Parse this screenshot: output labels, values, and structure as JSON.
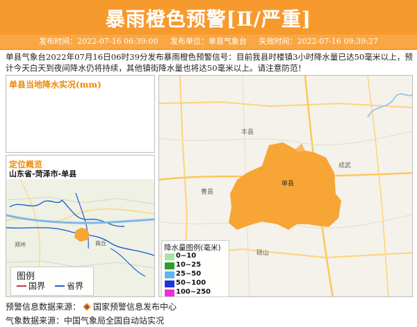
{
  "header": {
    "title": "暴雨橙色预警[Ⅱ/严重]",
    "publish_time": "发布时间：2022-07-16 06:39:00",
    "publisher": "发布单位：单县气象台",
    "expire_time": "失效时间：2022-07-16 09:39:27",
    "color": "#f79a2e"
  },
  "description": "单县气象台2022年07月16日06时39分发布暴雨橙色预警信号：目前我县时楼镇3小时降水量已达50毫米以上，预计今天白天到夜间降水仍将持续，其他镇街降水量也将达50毫米以上。请注意防范！",
  "rain_panel": {
    "title": "单县当地降水实况(mm)"
  },
  "location_panel": {
    "title": "定位概览",
    "path": "山东省-菏泽市-单县",
    "map_labels": [
      "郑州",
      "商丘"
    ],
    "legend": {
      "title": "图例",
      "items": [
        {
          "label": "国界",
          "color": "#c0394b"
        },
        {
          "label": "省界",
          "color": "#1f5fd1"
        }
      ]
    }
  },
  "main_map": {
    "labels": [
      "丰县",
      "单县",
      "成武",
      "曹县",
      "砀山"
    ],
    "region_color": "#f7a534"
  },
  "rain_legend": {
    "title": "降水量图例(毫米)",
    "items": [
      {
        "label": "0~10",
        "color": "#a8e6a0"
      },
      {
        "label": "10~25",
        "color": "#2c9e2c"
      },
      {
        "label": "25~50",
        "color": "#62b3f4"
      },
      {
        "label": "50~100",
        "color": "#1d36d6"
      },
      {
        "label": "100~250",
        "color": "#ee2fd8"
      }
    ]
  },
  "sources": {
    "warning_source_label": "预警信息数据来源：",
    "warning_source_name": "国家预警信息发布中心",
    "weather_source_label": "气象数据来源：",
    "weather_source_name": "中国气象局全国自动站实况"
  }
}
